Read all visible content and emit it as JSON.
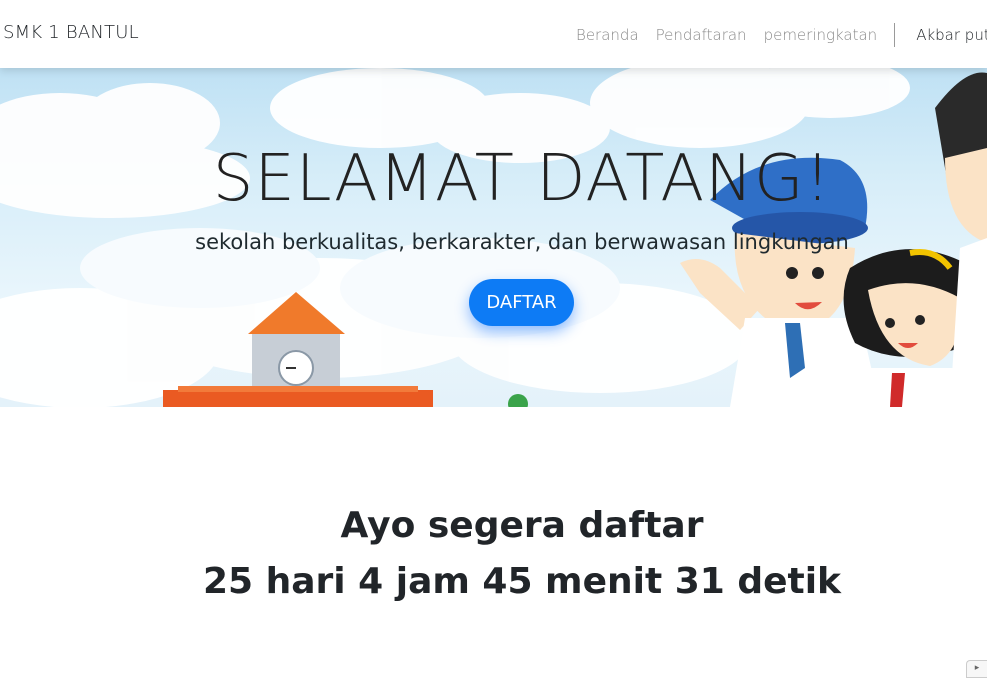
{
  "navbar": {
    "brand": "SMK 1 BANTUL",
    "links": [
      "Beranda",
      "Pendaftaran",
      "pemeringkatan"
    ],
    "user": "Akbar putra p"
  },
  "hero": {
    "title": "SELAMAT DATANG!",
    "subtitle": "sekolah berkualitas, berkarakter, dan berwawasan lingkungan",
    "button": "DAFTAR"
  },
  "countdown": {
    "heading": "Ayo segera daftar",
    "text": "25 hari 4 jam 45 menit 31 detik"
  },
  "colors": {
    "primary": "#0d7bf5",
    "sky": "#cfe9f7"
  }
}
